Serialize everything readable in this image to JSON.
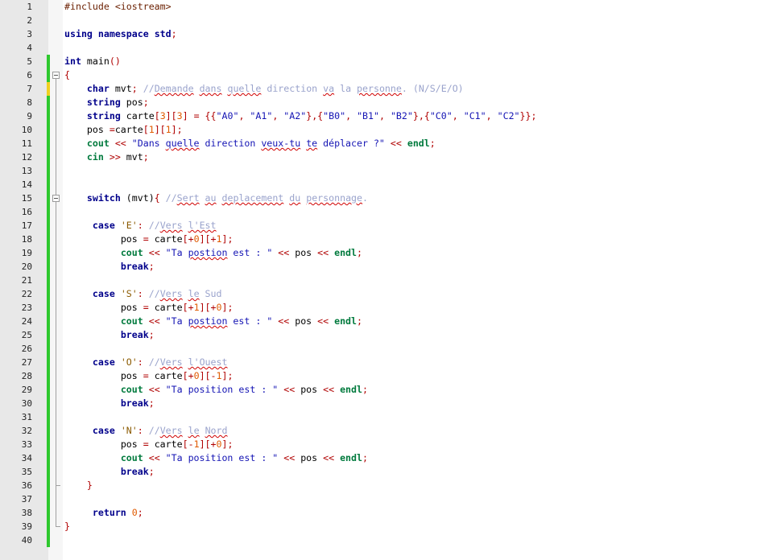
{
  "editor": {
    "line_numbers": [
      "1",
      "2",
      "3",
      "4",
      "5",
      "6",
      "7",
      "8",
      "9",
      "10",
      "11",
      "12",
      "13",
      "14",
      "15",
      "16",
      "17",
      "18",
      "19",
      "20",
      "21",
      "22",
      "23",
      "24",
      "25",
      "26",
      "27",
      "28",
      "29",
      "30",
      "31",
      "32",
      "33",
      "34",
      "35",
      "36",
      "37",
      "38",
      "39",
      "40"
    ],
    "lines": [
      {
        "indent": "",
        "tokens": [
          {
            "t": "#include <iostream>",
            "c": "pp"
          }
        ]
      },
      {
        "indent": "",
        "tokens": []
      },
      {
        "indent": "",
        "tokens": [
          {
            "t": "using",
            "c": "kw"
          },
          {
            "t": " ",
            "c": ""
          },
          {
            "t": "namespace",
            "c": "kw"
          },
          {
            "t": " ",
            "c": ""
          },
          {
            "t": "std",
            "c": "kw"
          },
          {
            "t": ";",
            "c": "op"
          }
        ]
      },
      {
        "indent": "",
        "tokens": []
      },
      {
        "indent": "",
        "tokens": [
          {
            "t": "int",
            "c": "tp"
          },
          {
            "t": " main",
            "c": "fn"
          },
          {
            "t": "()",
            "c": "op"
          }
        ]
      },
      {
        "indent": "",
        "tokens": [
          {
            "t": "{",
            "c": "op"
          }
        ]
      },
      {
        "indent": "    ",
        "tokens": [
          {
            "t": "char",
            "c": "tp"
          },
          {
            "t": " mvt",
            "c": "fn"
          },
          {
            "t": ";",
            "c": "op"
          },
          {
            "t": " //",
            "c": "cm"
          },
          {
            "t": "Demande",
            "c": "cm wavy"
          },
          {
            "t": " ",
            "c": "cm"
          },
          {
            "t": "dans",
            "c": "cm wavy"
          },
          {
            "t": " ",
            "c": "cm"
          },
          {
            "t": "quelle",
            "c": "cm wavy"
          },
          {
            "t": " direction ",
            "c": "cm"
          },
          {
            "t": "va",
            "c": "cm wavy"
          },
          {
            "t": " la ",
            "c": "cm"
          },
          {
            "t": "personne",
            "c": "cm wavy"
          },
          {
            "t": ". (N/S/E/O)",
            "c": "cm"
          }
        ]
      },
      {
        "indent": "    ",
        "tokens": [
          {
            "t": "string",
            "c": "tp"
          },
          {
            "t": " pos",
            "c": "fn"
          },
          {
            "t": ";",
            "c": "op"
          }
        ]
      },
      {
        "indent": "    ",
        "tokens": [
          {
            "t": "string",
            "c": "tp"
          },
          {
            "t": " carte",
            "c": "fn"
          },
          {
            "t": "[",
            "c": "op"
          },
          {
            "t": "3",
            "c": "num"
          },
          {
            "t": "][",
            "c": "op"
          },
          {
            "t": "3",
            "c": "num"
          },
          {
            "t": "] = {{",
            "c": "op"
          },
          {
            "t": "\"A0\"",
            "c": "str2"
          },
          {
            "t": ", ",
            "c": "op"
          },
          {
            "t": "\"A1\"",
            "c": "str2"
          },
          {
            "t": ", ",
            "c": "op"
          },
          {
            "t": "\"A2\"",
            "c": "str2"
          },
          {
            "t": "},{",
            "c": "op"
          },
          {
            "t": "\"B0\"",
            "c": "str2"
          },
          {
            "t": ", ",
            "c": "op"
          },
          {
            "t": "\"B1\"",
            "c": "str2"
          },
          {
            "t": ", ",
            "c": "op"
          },
          {
            "t": "\"B2\"",
            "c": "str2"
          },
          {
            "t": "},{",
            "c": "op"
          },
          {
            "t": "\"C0\"",
            "c": "str2"
          },
          {
            "t": ", ",
            "c": "op"
          },
          {
            "t": "\"C1\"",
            "c": "str2"
          },
          {
            "t": ", ",
            "c": "op"
          },
          {
            "t": "\"C2\"",
            "c": "str2"
          },
          {
            "t": "}};",
            "c": "op"
          }
        ]
      },
      {
        "indent": "    ",
        "tokens": [
          {
            "t": "pos ",
            "c": "fn"
          },
          {
            "t": "=",
            "c": "op"
          },
          {
            "t": "carte",
            "c": "fn"
          },
          {
            "t": "[",
            "c": "op"
          },
          {
            "t": "1",
            "c": "num"
          },
          {
            "t": "][",
            "c": "op"
          },
          {
            "t": "1",
            "c": "num"
          },
          {
            "t": "];",
            "c": "op"
          }
        ]
      },
      {
        "indent": "    ",
        "tokens": [
          {
            "t": "cout",
            "c": "cyan"
          },
          {
            "t": " << ",
            "c": "op"
          },
          {
            "t": "\"Dans ",
            "c": "str2"
          },
          {
            "t": "quelle",
            "c": "str2 wavy"
          },
          {
            "t": " direction ",
            "c": "str2"
          },
          {
            "t": "veux-tu",
            "c": "str2 wavy"
          },
          {
            "t": " ",
            "c": "str2"
          },
          {
            "t": "te",
            "c": "str2 wavy"
          },
          {
            "t": " déplacer ?\"",
            "c": "str2"
          },
          {
            "t": " << ",
            "c": "op"
          },
          {
            "t": "endl",
            "c": "cyan"
          },
          {
            "t": ";",
            "c": "op"
          }
        ]
      },
      {
        "indent": "    ",
        "tokens": [
          {
            "t": "cin",
            "c": "cyan"
          },
          {
            "t": " >> ",
            "c": "op"
          },
          {
            "t": "mvt",
            "c": "fn"
          },
          {
            "t": ";",
            "c": "op"
          }
        ]
      },
      {
        "indent": "",
        "tokens": []
      },
      {
        "indent": "",
        "tokens": []
      },
      {
        "indent": "    ",
        "tokens": [
          {
            "t": "switch",
            "c": "kw"
          },
          {
            "t": " (mvt)",
            "c": "fn"
          },
          {
            "t": "{",
            "c": "op"
          },
          {
            "t": " //",
            "c": "cm"
          },
          {
            "t": "Sert",
            "c": "cm wavy"
          },
          {
            "t": " ",
            "c": "cm"
          },
          {
            "t": "au",
            "c": "cm wavy"
          },
          {
            "t": " ",
            "c": "cm"
          },
          {
            "t": "deplacement",
            "c": "cm wavy"
          },
          {
            "t": " ",
            "c": "cm"
          },
          {
            "t": "du",
            "c": "cm wavy"
          },
          {
            "t": " ",
            "c": "cm"
          },
          {
            "t": "personnage",
            "c": "cm wavy"
          },
          {
            "t": ".",
            "c": "cm"
          }
        ]
      },
      {
        "indent": "",
        "tokens": []
      },
      {
        "indent": "     ",
        "tokens": [
          {
            "t": "case",
            "c": "kw"
          },
          {
            "t": " ",
            "c": ""
          },
          {
            "t": "'E'",
            "c": "str"
          },
          {
            "t": ":",
            "c": "op"
          },
          {
            "t": " //",
            "c": "cm"
          },
          {
            "t": "Vers",
            "c": "cm wavy"
          },
          {
            "t": " ",
            "c": "cm"
          },
          {
            "t": "l'Est",
            "c": "cm wavy"
          }
        ]
      },
      {
        "indent": "          ",
        "tokens": [
          {
            "t": "pos ",
            "c": "fn"
          },
          {
            "t": "=",
            "c": "op"
          },
          {
            "t": " carte",
            "c": "fn"
          },
          {
            "t": "[+",
            "c": "op"
          },
          {
            "t": "0",
            "c": "num"
          },
          {
            "t": "][+",
            "c": "op"
          },
          {
            "t": "1",
            "c": "num"
          },
          {
            "t": "];",
            "c": "op"
          }
        ]
      },
      {
        "indent": "          ",
        "tokens": [
          {
            "t": "cout",
            "c": "cyan"
          },
          {
            "t": " << ",
            "c": "op"
          },
          {
            "t": "\"Ta ",
            "c": "str2"
          },
          {
            "t": "postion",
            "c": "str2 wavy"
          },
          {
            "t": " est : \"",
            "c": "str2"
          },
          {
            "t": " << ",
            "c": "op"
          },
          {
            "t": "pos",
            "c": "fn"
          },
          {
            "t": " << ",
            "c": "op"
          },
          {
            "t": "endl",
            "c": "cyan"
          },
          {
            "t": ";",
            "c": "op"
          }
        ]
      },
      {
        "indent": "          ",
        "tokens": [
          {
            "t": "break",
            "c": "kw"
          },
          {
            "t": ";",
            "c": "op"
          }
        ]
      },
      {
        "indent": "",
        "tokens": []
      },
      {
        "indent": "     ",
        "tokens": [
          {
            "t": "case",
            "c": "kw"
          },
          {
            "t": " ",
            "c": ""
          },
          {
            "t": "'S'",
            "c": "str"
          },
          {
            "t": ":",
            "c": "op"
          },
          {
            "t": " //",
            "c": "cm"
          },
          {
            "t": "Vers",
            "c": "cm wavy"
          },
          {
            "t": " ",
            "c": "cm"
          },
          {
            "t": "le",
            "c": "cm wavy"
          },
          {
            "t": " Sud",
            "c": "cm"
          }
        ]
      },
      {
        "indent": "          ",
        "tokens": [
          {
            "t": "pos ",
            "c": "fn"
          },
          {
            "t": "=",
            "c": "op"
          },
          {
            "t": " carte",
            "c": "fn"
          },
          {
            "t": "[+",
            "c": "op"
          },
          {
            "t": "1",
            "c": "num"
          },
          {
            "t": "][+",
            "c": "op"
          },
          {
            "t": "0",
            "c": "num"
          },
          {
            "t": "];",
            "c": "op"
          }
        ]
      },
      {
        "indent": "          ",
        "tokens": [
          {
            "t": "cout",
            "c": "cyan"
          },
          {
            "t": " << ",
            "c": "op"
          },
          {
            "t": "\"Ta ",
            "c": "str2"
          },
          {
            "t": "postion",
            "c": "str2 wavy"
          },
          {
            "t": " est : \"",
            "c": "str2"
          },
          {
            "t": " << ",
            "c": "op"
          },
          {
            "t": "pos",
            "c": "fn"
          },
          {
            "t": " << ",
            "c": "op"
          },
          {
            "t": "endl",
            "c": "cyan"
          },
          {
            "t": ";",
            "c": "op"
          }
        ]
      },
      {
        "indent": "          ",
        "tokens": [
          {
            "t": "break",
            "c": "kw"
          },
          {
            "t": ";",
            "c": "op"
          }
        ]
      },
      {
        "indent": "",
        "tokens": []
      },
      {
        "indent": "     ",
        "tokens": [
          {
            "t": "case",
            "c": "kw"
          },
          {
            "t": " ",
            "c": ""
          },
          {
            "t": "'O'",
            "c": "str"
          },
          {
            "t": ":",
            "c": "op"
          },
          {
            "t": " //",
            "c": "cm"
          },
          {
            "t": "Vers",
            "c": "cm wavy"
          },
          {
            "t": " ",
            "c": "cm"
          },
          {
            "t": "l'Ouest",
            "c": "cm wavy"
          }
        ]
      },
      {
        "indent": "          ",
        "tokens": [
          {
            "t": "pos ",
            "c": "fn"
          },
          {
            "t": "=",
            "c": "op"
          },
          {
            "t": " carte",
            "c": "fn"
          },
          {
            "t": "[+",
            "c": "op"
          },
          {
            "t": "0",
            "c": "num"
          },
          {
            "t": "][-",
            "c": "op"
          },
          {
            "t": "1",
            "c": "num"
          },
          {
            "t": "];",
            "c": "op"
          }
        ]
      },
      {
        "indent": "          ",
        "tokens": [
          {
            "t": "cout",
            "c": "cyan"
          },
          {
            "t": " << ",
            "c": "op"
          },
          {
            "t": "\"Ta position est : \"",
            "c": "str2"
          },
          {
            "t": " << ",
            "c": "op"
          },
          {
            "t": "pos",
            "c": "fn"
          },
          {
            "t": " << ",
            "c": "op"
          },
          {
            "t": "endl",
            "c": "cyan"
          },
          {
            "t": ";",
            "c": "op"
          }
        ]
      },
      {
        "indent": "          ",
        "tokens": [
          {
            "t": "break",
            "c": "kw"
          },
          {
            "t": ";",
            "c": "op"
          }
        ]
      },
      {
        "indent": "",
        "tokens": []
      },
      {
        "indent": "     ",
        "tokens": [
          {
            "t": "case",
            "c": "kw"
          },
          {
            "t": " ",
            "c": ""
          },
          {
            "t": "'N'",
            "c": "str"
          },
          {
            "t": ":",
            "c": "op"
          },
          {
            "t": " //",
            "c": "cm"
          },
          {
            "t": "Vers",
            "c": "cm wavy"
          },
          {
            "t": " ",
            "c": "cm"
          },
          {
            "t": "le",
            "c": "cm wavy"
          },
          {
            "t": " ",
            "c": "cm"
          },
          {
            "t": "Nord",
            "c": "cm wavy"
          }
        ]
      },
      {
        "indent": "          ",
        "tokens": [
          {
            "t": "pos ",
            "c": "fn"
          },
          {
            "t": "=",
            "c": "op"
          },
          {
            "t": " carte",
            "c": "fn"
          },
          {
            "t": "[-",
            "c": "op"
          },
          {
            "t": "1",
            "c": "num"
          },
          {
            "t": "][+",
            "c": "op"
          },
          {
            "t": "0",
            "c": "num"
          },
          {
            "t": "];",
            "c": "op"
          }
        ]
      },
      {
        "indent": "          ",
        "tokens": [
          {
            "t": "cout",
            "c": "cyan"
          },
          {
            "t": " << ",
            "c": "op"
          },
          {
            "t": "\"Ta position est : \"",
            "c": "str2"
          },
          {
            "t": " << ",
            "c": "op"
          },
          {
            "t": "pos",
            "c": "fn"
          },
          {
            "t": " << ",
            "c": "op"
          },
          {
            "t": "endl",
            "c": "cyan"
          },
          {
            "t": ";",
            "c": "op"
          }
        ]
      },
      {
        "indent": "          ",
        "tokens": [
          {
            "t": "break",
            "c": "kw"
          },
          {
            "t": ";",
            "c": "op"
          }
        ]
      },
      {
        "indent": "    ",
        "tokens": [
          {
            "t": "}",
            "c": "op"
          }
        ]
      },
      {
        "indent": "",
        "tokens": []
      },
      {
        "indent": "     ",
        "tokens": [
          {
            "t": "return",
            "c": "kw"
          },
          {
            "t": " ",
            "c": ""
          },
          {
            "t": "0",
            "c": "num"
          },
          {
            "t": ";",
            "c": "op"
          }
        ]
      },
      {
        "indent": "",
        "tokens": [
          {
            "t": "}",
            "c": "op"
          }
        ]
      },
      {
        "indent": "",
        "tokens": []
      }
    ]
  },
  "colors": {
    "gutter_bg": "#e8e8e8",
    "change_bar_saved": "#2ec82e",
    "change_bar_unsaved": "#f0d020",
    "keyword": "#00008b",
    "string": "#1414b4",
    "comment": "#9aa3cc",
    "operator": "#b00000",
    "number": "#e05a00",
    "stream": "#007a3d"
  }
}
